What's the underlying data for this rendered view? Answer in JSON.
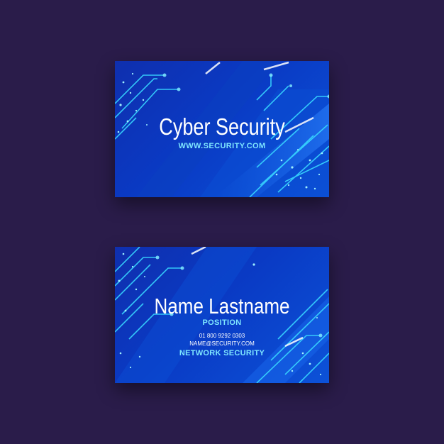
{
  "front_card": {
    "title": "Cyber Security",
    "website": "WWW.SECURITY.COM"
  },
  "back_card": {
    "name": "Name Lastname",
    "position": "POSITION",
    "phone": "01 800 9292 0303",
    "email": "NAME@SECURITY.COM",
    "company": "NETWORK SECURITY"
  },
  "colors": {
    "background": "#2a1c4a",
    "card_blue": "#0a3ac4",
    "accent_cyan": "#7fe7ff",
    "text_white": "#ffffff"
  }
}
